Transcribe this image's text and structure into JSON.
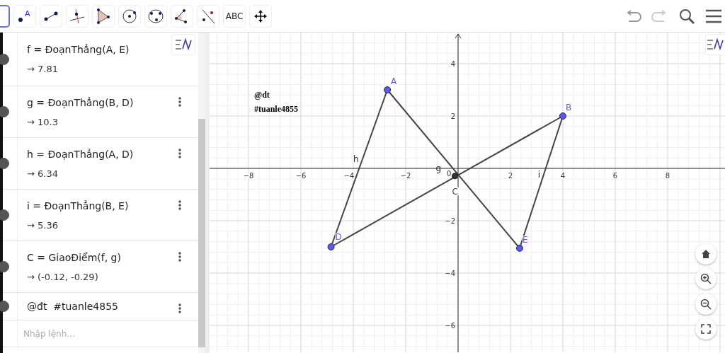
{
  "toolbar": {
    "tools": [
      {
        "kind": "move",
        "selected": true
      },
      {
        "kind": "point",
        "label": "A",
        "selected": false
      },
      {
        "kind": "segment",
        "selected": false
      },
      {
        "kind": "perpendicular",
        "selected": false
      },
      {
        "kind": "polygon",
        "selected": false
      },
      {
        "kind": "circle",
        "selected": false
      },
      {
        "kind": "circle3",
        "selected": false
      },
      {
        "kind": "angle",
        "selected": false
      },
      {
        "kind": "reflect",
        "selected": false
      },
      {
        "kind": "text",
        "label": "ABC",
        "selected": false
      },
      {
        "kind": "pan",
        "selected": false
      }
    ]
  },
  "algebra": {
    "items": [
      {
        "kind": "formula",
        "definition": "f = ĐoạnThẳng(A, E)",
        "value": "→ 7.81",
        "visible": true
      },
      {
        "kind": "formula",
        "definition": "g = ĐoạnThẳng(B, D)",
        "value": "→ 10.3",
        "visible": true
      },
      {
        "kind": "formula",
        "definition": "h = ĐoạnThẳng(A, D)",
        "value": "→ 6.34",
        "visible": true
      },
      {
        "kind": "formula",
        "definition": "i = ĐoạnThẳng(B, E)",
        "value": "→ 5.36",
        "visible": true
      },
      {
        "kind": "formula",
        "definition": "C = GiaoĐiểm(f, g)",
        "value": "→ (-0.12, -0.29)",
        "visible": true
      },
      {
        "kind": "text",
        "definition": "@đt  #tuanle4855",
        "visible": true
      }
    ],
    "input": {
      "placeholder": "Nhập lệnh..."
    }
  },
  "graphics": {
    "annotation": [
      "@dt",
      "#tuanle4855"
    ],
    "points": [
      "A",
      "B",
      "D",
      "E"
    ],
    "intersection": "C",
    "segment_labels": [
      "h",
      "g",
      "i"
    ],
    "x_ticks": [
      "−8",
      "−6",
      "−4",
      "−2",
      "2",
      "4",
      "6",
      "8"
    ],
    "y_ticks": [
      "4",
      "2",
      "−2",
      "−4",
      "−6"
    ],
    "origin": "0"
  }
}
